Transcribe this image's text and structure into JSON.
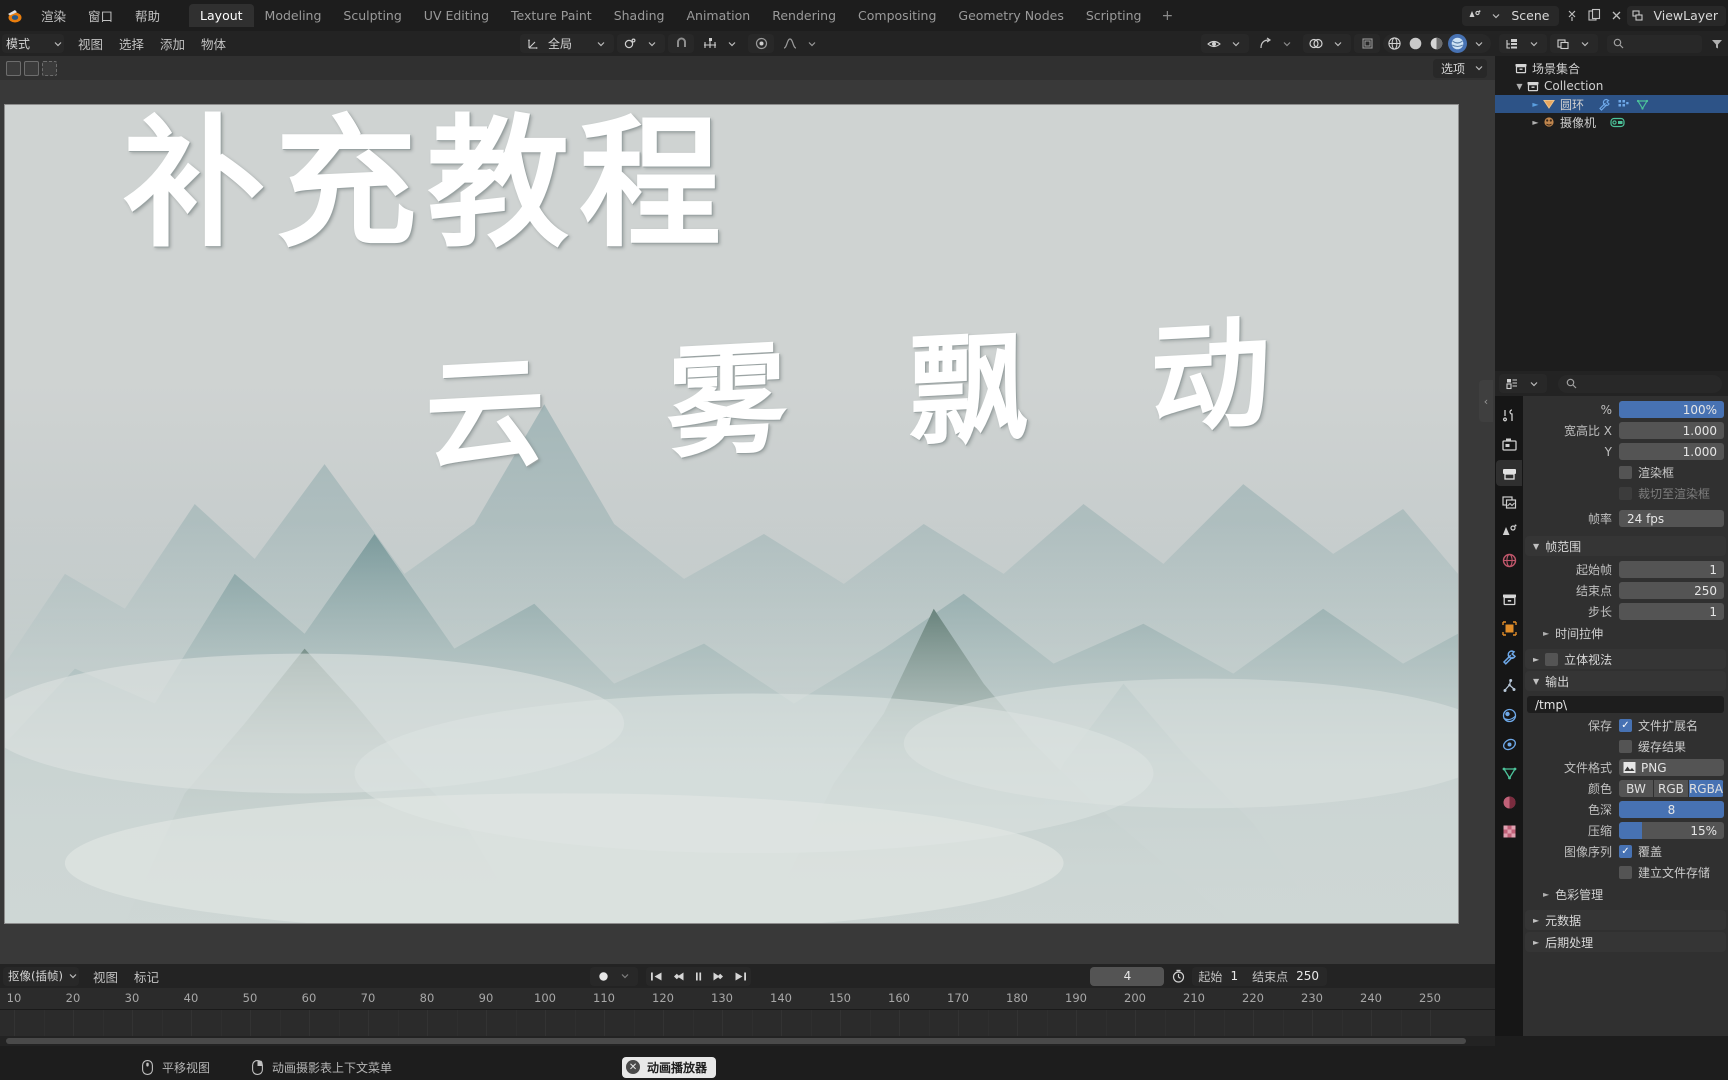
{
  "app": {
    "title": "Blender",
    "scene_name": "Scene",
    "view_layer_name": "ViewLayer"
  },
  "topbar": {
    "menus": [
      "渲染",
      "窗口",
      "帮助"
    ],
    "workspaces": [
      {
        "label": "Layout",
        "active": true
      },
      {
        "label": "Modeling",
        "active": false
      },
      {
        "label": "Sculpting",
        "active": false
      },
      {
        "label": "UV Editing",
        "active": false
      },
      {
        "label": "Texture Paint",
        "active": false
      },
      {
        "label": "Shading",
        "active": false
      },
      {
        "label": "Animation",
        "active": false
      },
      {
        "label": "Rendering",
        "active": false
      },
      {
        "label": "Compositing",
        "active": false
      },
      {
        "label": "Geometry Nodes",
        "active": false
      },
      {
        "label": "Scripting",
        "active": false
      }
    ],
    "add_workspace": "+"
  },
  "viewport_header": {
    "mode": "模式",
    "menus": [
      "视图",
      "选择",
      "添加",
      "物体"
    ],
    "orientation": "全局",
    "options_label": "选项"
  },
  "viewport": {
    "title_text": "补充教程",
    "subtitle_text": "云 雾 飘 动"
  },
  "outliner": {
    "items": [
      {
        "label": "场景集合",
        "indent": 0,
        "expander": "",
        "selected": false,
        "icon": "collection-icon"
      },
      {
        "label": "Collection",
        "indent": 1,
        "expander": "▼",
        "selected": false,
        "icon": "collection-icon"
      },
      {
        "label": "圆环",
        "indent": 2,
        "expander": "►",
        "selected": true,
        "icon": "mesh-data-icon"
      },
      {
        "label": "摄像机",
        "indent": 2,
        "expander": "►",
        "selected": false,
        "icon": "camera-icon"
      }
    ]
  },
  "properties": {
    "tabs": [
      {
        "name": "tool",
        "active": false
      },
      {
        "name": "render",
        "active": false
      },
      {
        "name": "output",
        "active": true
      },
      {
        "name": "view-layer",
        "active": false
      },
      {
        "name": "scene",
        "active": false
      },
      {
        "name": "world",
        "active": false
      },
      {
        "name": "collection",
        "active": false
      },
      {
        "name": "object",
        "active": false
      },
      {
        "name": "modifiers",
        "active": false
      },
      {
        "name": "particles",
        "active": false
      },
      {
        "name": "physics",
        "active": false
      },
      {
        "name": "constraints",
        "active": false
      },
      {
        "name": "object-data",
        "active": false
      },
      {
        "name": "material",
        "active": false
      },
      {
        "name": "texture",
        "active": false
      }
    ],
    "format": {
      "percent_label": "%",
      "percent_value": "100%",
      "aspect_x_label": "宽高比 X",
      "aspect_x_value": "1.000",
      "aspect_y_label": "Y",
      "aspect_y_value": "1.000",
      "render_region_label": "渲染框",
      "render_region_checked": false,
      "crop_render_region_label": "裁切至渲染框",
      "crop_render_region_checked": false,
      "frame_rate_label": "帧率",
      "frame_rate_value": "24 fps"
    },
    "frame_range": {
      "title": "帧范围",
      "start_label": "起始帧",
      "start_value": "1",
      "end_label": "结束点",
      "end_value": "250",
      "step_label": "步长",
      "step_value": "1",
      "time_stretch_label": "时间拉伸"
    },
    "stereoscopy": {
      "title": "立体视法",
      "checked": false
    },
    "output": {
      "title": "输出",
      "path": "/tmp\\",
      "saving_label": "保存",
      "file_extensions_label": "文件扩展名",
      "file_extensions_checked": true,
      "cache_result_label": "缓存结果",
      "cache_result_checked": false,
      "file_format_label": "文件格式",
      "file_format_value": "PNG",
      "color_label": "颜色",
      "color_options": [
        "BW",
        "RGB",
        "RGBA"
      ],
      "color_selected": "RGBA",
      "color_depth_label": "色深",
      "color_depth_value": "8",
      "compression_label": "压缩",
      "compression_value": "15%",
      "image_sequence_label": "图像序列",
      "overwrite_label": "覆盖",
      "overwrite_checked": true,
      "placeholders_label": "建立文件存储",
      "placeholders_checked": false
    },
    "collapsed_panels": [
      {
        "title": "色彩管理",
        "indent": true
      },
      {
        "title": "元数据",
        "indent": false
      },
      {
        "title": "后期处理",
        "indent": false
      }
    ]
  },
  "timeline": {
    "editor_type": "抠像(插帧)",
    "menus": [
      "视图",
      "标记"
    ],
    "current_frame": "4",
    "start_label": "起始",
    "start_value": "1",
    "end_label": "结束点",
    "end_value": "250",
    "ruler_ticks": [
      "10",
      "20",
      "30",
      "40",
      "50",
      "60",
      "70",
      "80",
      "90",
      "100",
      "110",
      "120",
      "130",
      "140",
      "150",
      "160",
      "170",
      "180",
      "190",
      "200",
      "210",
      "220",
      "230",
      "240",
      "250"
    ],
    "playhead_frame": "4"
  },
  "statusbar": {
    "items": [
      {
        "icon": "mouse-middle-icon",
        "text": "平移视图"
      },
      {
        "icon": "mouse-right-icon",
        "text": "动画摄影表上下文菜单"
      }
    ],
    "chip": {
      "icon": "close-icon",
      "text": "动画播放器"
    }
  },
  "colors": {
    "accent_blue": "#4772b3",
    "selection_blue": "#2d5387",
    "panel_bg": "#303030",
    "header_bg": "#232323",
    "window_bg": "#1d1d1d"
  }
}
